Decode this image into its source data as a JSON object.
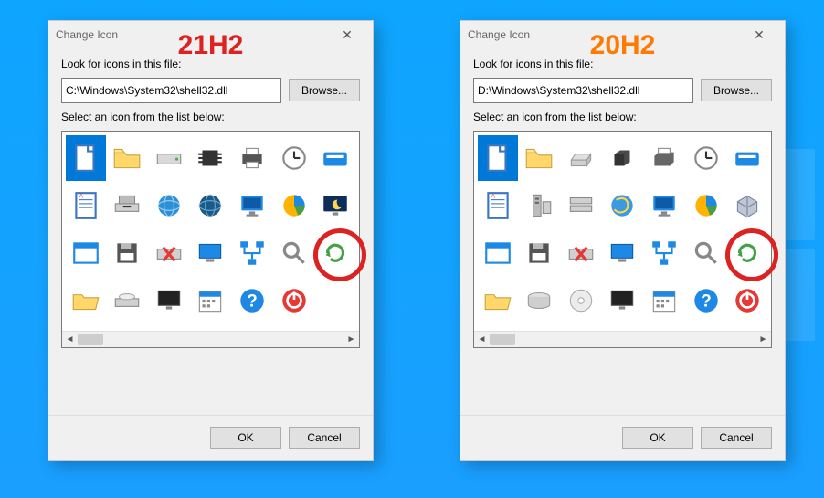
{
  "dialogs": [
    {
      "title": "Change Icon",
      "overlay": "21H2",
      "look_label": "Look for icons in this file:",
      "path_value": "C:\\Windows\\System32\\shell32.dll",
      "browse_label": "Browse...",
      "select_label": "Select an icon from the list below:",
      "ok_label": "OK",
      "cancel_label": "Cancel",
      "selected_index": 0,
      "icons": [
        "document",
        "folder",
        "drive",
        "chip",
        "printer",
        "clock",
        "run",
        "document-lines",
        "floppy-drive",
        "globe-blue",
        "globe-dark",
        "monitor",
        "chart",
        "sleep-monitor",
        "window",
        "floppy",
        "drive-x",
        "monitor2",
        "network",
        "search",
        "refresh",
        "folder-open",
        "cd-drive",
        "monitor3",
        "calendar",
        "help",
        "power",
        "blank"
      ]
    },
    {
      "title": "Change Icon",
      "overlay": "20H2",
      "look_label": "Look for icons in this file:",
      "path_value": "D:\\Windows\\System32\\shell32.dll",
      "browse_label": "Browse...",
      "select_label": "Select an icon from the list below:",
      "ok_label": "OK",
      "cancel_label": "Cancel",
      "selected_index": 0,
      "icons": [
        "document",
        "folder",
        "drive-3d",
        "chip-3d",
        "printer-3d",
        "clock",
        "run",
        "document-lines",
        "tower",
        "drive-stack",
        "globe-ie",
        "monitor",
        "chart",
        "cube",
        "window",
        "floppy",
        "drive-x",
        "monitor2",
        "network",
        "search",
        "refresh",
        "folder-open",
        "drive-round",
        "cd",
        "monitor3",
        "calendar",
        "help",
        "power"
      ]
    }
  ]
}
